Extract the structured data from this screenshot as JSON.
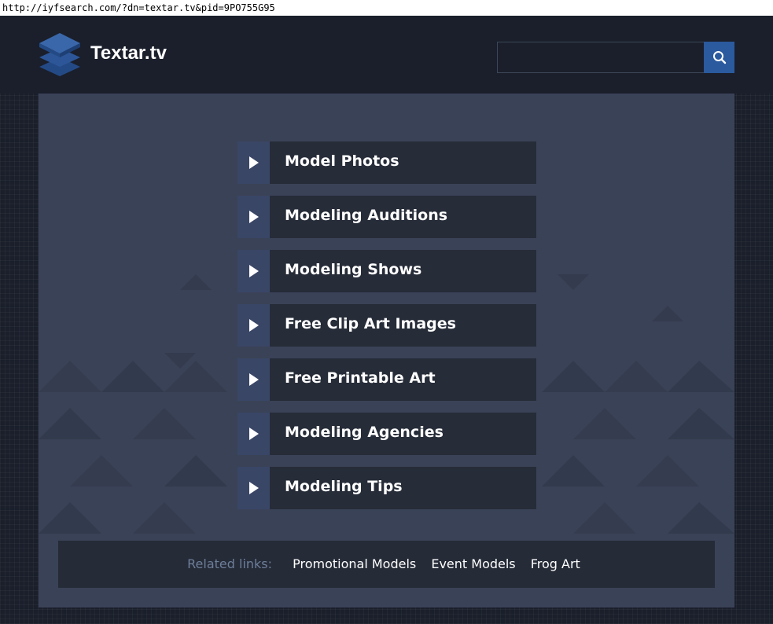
{
  "browser": {
    "url": "http://iyfsearch.com/?dn=textar.tv&pid=9PO755G95"
  },
  "header": {
    "logo_icon": "stacked-layers-icon",
    "site_name": "Textar.tv",
    "search": {
      "value": "",
      "placeholder": "",
      "button_icon": "search-icon"
    }
  },
  "links": [
    {
      "label": "Model Photos"
    },
    {
      "label": "Modeling Auditions"
    },
    {
      "label": "Modeling Shows"
    },
    {
      "label": "Free Clip Art Images"
    },
    {
      "label": "Free Printable Art"
    },
    {
      "label": "Modeling Agencies"
    },
    {
      "label": "Modeling Tips"
    }
  ],
  "related": {
    "label": "Related links:",
    "links": [
      "Promotional Models",
      "Event Models",
      "Frog Art"
    ]
  },
  "colors": {
    "page_background": "#1a1f2b",
    "panel_background": "#3a4257",
    "link_background": "#262c38",
    "arrow_box": "#3a4666",
    "search_button": "#2b5a9e",
    "related_label": "#6d7e9a"
  }
}
